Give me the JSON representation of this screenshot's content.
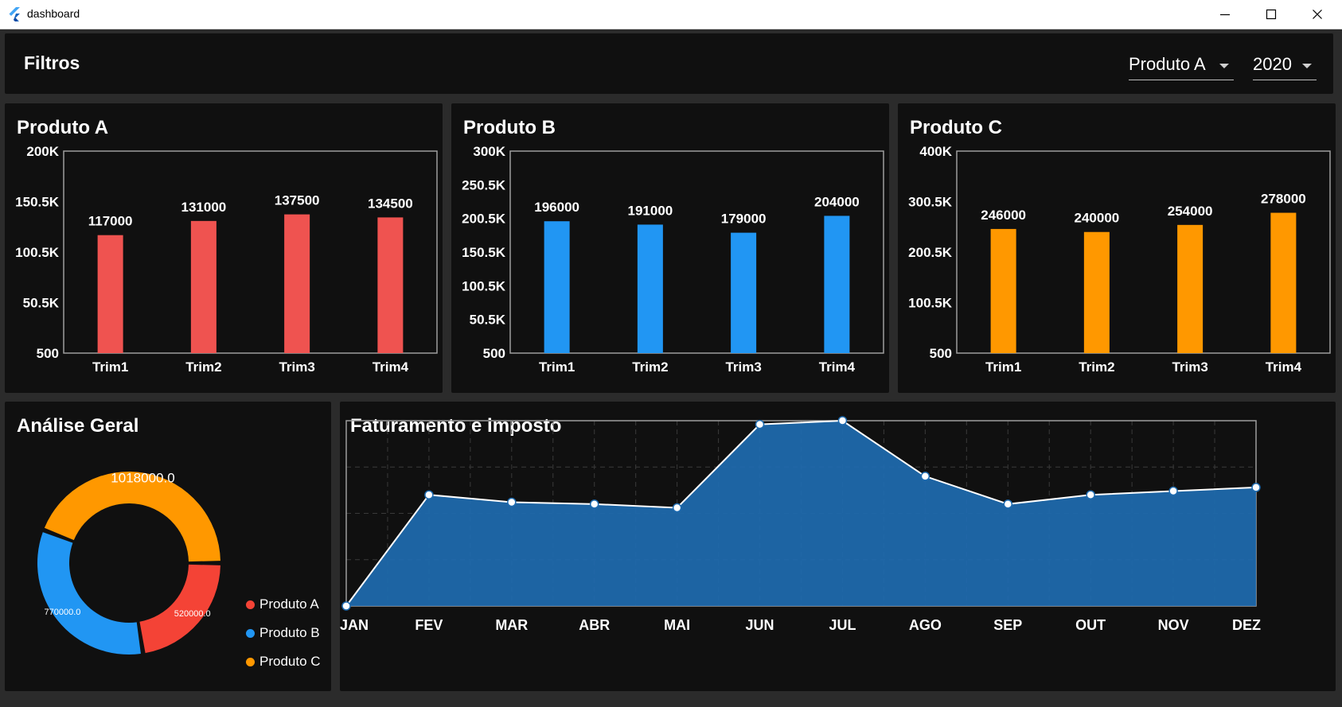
{
  "window": {
    "title": "dashboard",
    "minimize_icon": "minimize-icon",
    "maximize_icon": "maximize-icon",
    "close_icon": "close-icon"
  },
  "filters": {
    "title": "Filtros",
    "product_select": {
      "value": "Produto A"
    },
    "year_select": {
      "value": "2020"
    }
  },
  "colors": {
    "produto_a": "#ef5350",
    "produto_b": "#2196f3",
    "produto_c": "#ff9800",
    "area_fill": "#1e6bb0",
    "panel_bg": "#101010",
    "page_bg": "#2b2b2b"
  },
  "chart_data": [
    {
      "id": "produto_a",
      "type": "bar",
      "title": "Produto A",
      "categories": [
        "Trim1",
        "Trim2",
        "Trim3",
        "Trim4"
      ],
      "values": [
        117000,
        131000,
        137500,
        134500
      ],
      "value_labels": [
        "117000",
        "131000",
        "137500",
        "134500"
      ],
      "ytick_labels": [
        "500",
        "50.5K",
        "100.5K",
        "150.5K",
        "200K"
      ],
      "ylim": [
        500,
        200000
      ],
      "color": "#ef5350"
    },
    {
      "id": "produto_b",
      "type": "bar",
      "title": "Produto B",
      "categories": [
        "Trim1",
        "Trim2",
        "Trim3",
        "Trim4"
      ],
      "values": [
        196000,
        191000,
        179000,
        204000
      ],
      "value_labels": [
        "196000",
        "191000",
        "179000",
        "204000"
      ],
      "ytick_labels": [
        "500",
        "50.5K",
        "100.5K",
        "150.5K",
        "200.5K",
        "250.5K",
        "300K"
      ],
      "ylim": [
        500,
        300000
      ],
      "color": "#2196f3"
    },
    {
      "id": "produto_c",
      "type": "bar",
      "title": "Produto C",
      "categories": [
        "Trim1",
        "Trim2",
        "Trim3",
        "Trim4"
      ],
      "values": [
        246000,
        240000,
        254000,
        278000
      ],
      "value_labels": [
        "246000",
        "240000",
        "254000",
        "278000"
      ],
      "ytick_labels": [
        "500",
        "100.5K",
        "200.5K",
        "300.5K",
        "400K"
      ],
      "ylim": [
        500,
        400000
      ],
      "color": "#ff9800"
    },
    {
      "id": "analise_geral",
      "type": "pie",
      "title": "Análise Geral",
      "labels": [
        "Produto A",
        "Produto B",
        "Produto C"
      ],
      "values": [
        520000,
        770000,
        1018000
      ],
      "value_labels": [
        "520000.0",
        "770000.0",
        "1018000.0"
      ],
      "colors": [
        "#f44336",
        "#2196f3",
        "#ff9800"
      ],
      "legend_position": "bottom-right"
    },
    {
      "id": "faturamento",
      "type": "area",
      "title": "Faturamento e imposto",
      "categories": [
        "JAN",
        "FEV",
        "MAR",
        "ABR",
        "MAI",
        "JUN",
        "JUL",
        "AGO",
        "SEP",
        "OUT",
        "NOV",
        "DEZ"
      ],
      "values": [
        0,
        6.0,
        5.6,
        5.5,
        5.3,
        9.8,
        10.0,
        7.0,
        5.5,
        6.0,
        6.2,
        6.4
      ],
      "ylim": [
        0,
        10.0
      ],
      "grid": true,
      "color": "#1e6bb0"
    }
  ]
}
